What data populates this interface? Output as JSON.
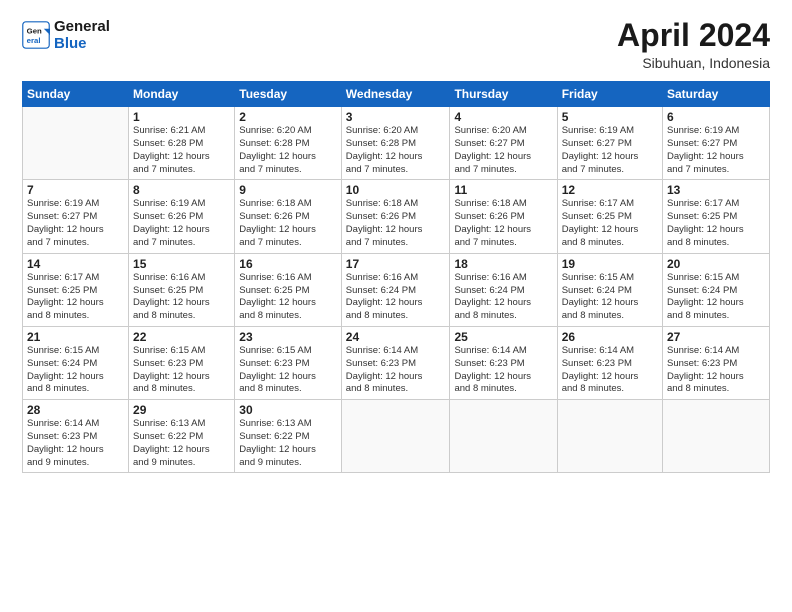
{
  "logo": {
    "line1": "General",
    "line2": "Blue"
  },
  "title": "April 2024",
  "subtitle": "Sibuhuan, Indonesia",
  "header_days": [
    "Sunday",
    "Monday",
    "Tuesday",
    "Wednesday",
    "Thursday",
    "Friday",
    "Saturday"
  ],
  "weeks": [
    [
      {
        "day": "",
        "info": ""
      },
      {
        "day": "1",
        "info": "Sunrise: 6:21 AM\nSunset: 6:28 PM\nDaylight: 12 hours\nand 7 minutes."
      },
      {
        "day": "2",
        "info": "Sunrise: 6:20 AM\nSunset: 6:28 PM\nDaylight: 12 hours\nand 7 minutes."
      },
      {
        "day": "3",
        "info": "Sunrise: 6:20 AM\nSunset: 6:28 PM\nDaylight: 12 hours\nand 7 minutes."
      },
      {
        "day": "4",
        "info": "Sunrise: 6:20 AM\nSunset: 6:27 PM\nDaylight: 12 hours\nand 7 minutes."
      },
      {
        "day": "5",
        "info": "Sunrise: 6:19 AM\nSunset: 6:27 PM\nDaylight: 12 hours\nand 7 minutes."
      },
      {
        "day": "6",
        "info": "Sunrise: 6:19 AM\nSunset: 6:27 PM\nDaylight: 12 hours\nand 7 minutes."
      }
    ],
    [
      {
        "day": "7",
        "info": "Sunrise: 6:19 AM\nSunset: 6:27 PM\nDaylight: 12 hours\nand 7 minutes."
      },
      {
        "day": "8",
        "info": "Sunrise: 6:19 AM\nSunset: 6:26 PM\nDaylight: 12 hours\nand 7 minutes."
      },
      {
        "day": "9",
        "info": "Sunrise: 6:18 AM\nSunset: 6:26 PM\nDaylight: 12 hours\nand 7 minutes."
      },
      {
        "day": "10",
        "info": "Sunrise: 6:18 AM\nSunset: 6:26 PM\nDaylight: 12 hours\nand 7 minutes."
      },
      {
        "day": "11",
        "info": "Sunrise: 6:18 AM\nSunset: 6:26 PM\nDaylight: 12 hours\nand 7 minutes."
      },
      {
        "day": "12",
        "info": "Sunrise: 6:17 AM\nSunset: 6:25 PM\nDaylight: 12 hours\nand 8 minutes."
      },
      {
        "day": "13",
        "info": "Sunrise: 6:17 AM\nSunset: 6:25 PM\nDaylight: 12 hours\nand 8 minutes."
      }
    ],
    [
      {
        "day": "14",
        "info": "Sunrise: 6:17 AM\nSunset: 6:25 PM\nDaylight: 12 hours\nand 8 minutes."
      },
      {
        "day": "15",
        "info": "Sunrise: 6:16 AM\nSunset: 6:25 PM\nDaylight: 12 hours\nand 8 minutes."
      },
      {
        "day": "16",
        "info": "Sunrise: 6:16 AM\nSunset: 6:25 PM\nDaylight: 12 hours\nand 8 minutes."
      },
      {
        "day": "17",
        "info": "Sunrise: 6:16 AM\nSunset: 6:24 PM\nDaylight: 12 hours\nand 8 minutes."
      },
      {
        "day": "18",
        "info": "Sunrise: 6:16 AM\nSunset: 6:24 PM\nDaylight: 12 hours\nand 8 minutes."
      },
      {
        "day": "19",
        "info": "Sunrise: 6:15 AM\nSunset: 6:24 PM\nDaylight: 12 hours\nand 8 minutes."
      },
      {
        "day": "20",
        "info": "Sunrise: 6:15 AM\nSunset: 6:24 PM\nDaylight: 12 hours\nand 8 minutes."
      }
    ],
    [
      {
        "day": "21",
        "info": "Sunrise: 6:15 AM\nSunset: 6:24 PM\nDaylight: 12 hours\nand 8 minutes."
      },
      {
        "day": "22",
        "info": "Sunrise: 6:15 AM\nSunset: 6:23 PM\nDaylight: 12 hours\nand 8 minutes."
      },
      {
        "day": "23",
        "info": "Sunrise: 6:15 AM\nSunset: 6:23 PM\nDaylight: 12 hours\nand 8 minutes."
      },
      {
        "day": "24",
        "info": "Sunrise: 6:14 AM\nSunset: 6:23 PM\nDaylight: 12 hours\nand 8 minutes."
      },
      {
        "day": "25",
        "info": "Sunrise: 6:14 AM\nSunset: 6:23 PM\nDaylight: 12 hours\nand 8 minutes."
      },
      {
        "day": "26",
        "info": "Sunrise: 6:14 AM\nSunset: 6:23 PM\nDaylight: 12 hours\nand 8 minutes."
      },
      {
        "day": "27",
        "info": "Sunrise: 6:14 AM\nSunset: 6:23 PM\nDaylight: 12 hours\nand 8 minutes."
      }
    ],
    [
      {
        "day": "28",
        "info": "Sunrise: 6:14 AM\nSunset: 6:23 PM\nDaylight: 12 hours\nand 9 minutes."
      },
      {
        "day": "29",
        "info": "Sunrise: 6:13 AM\nSunset: 6:22 PM\nDaylight: 12 hours\nand 9 minutes."
      },
      {
        "day": "30",
        "info": "Sunrise: 6:13 AM\nSunset: 6:22 PM\nDaylight: 12 hours\nand 9 minutes."
      },
      {
        "day": "",
        "info": ""
      },
      {
        "day": "",
        "info": ""
      },
      {
        "day": "",
        "info": ""
      },
      {
        "day": "",
        "info": ""
      }
    ]
  ]
}
